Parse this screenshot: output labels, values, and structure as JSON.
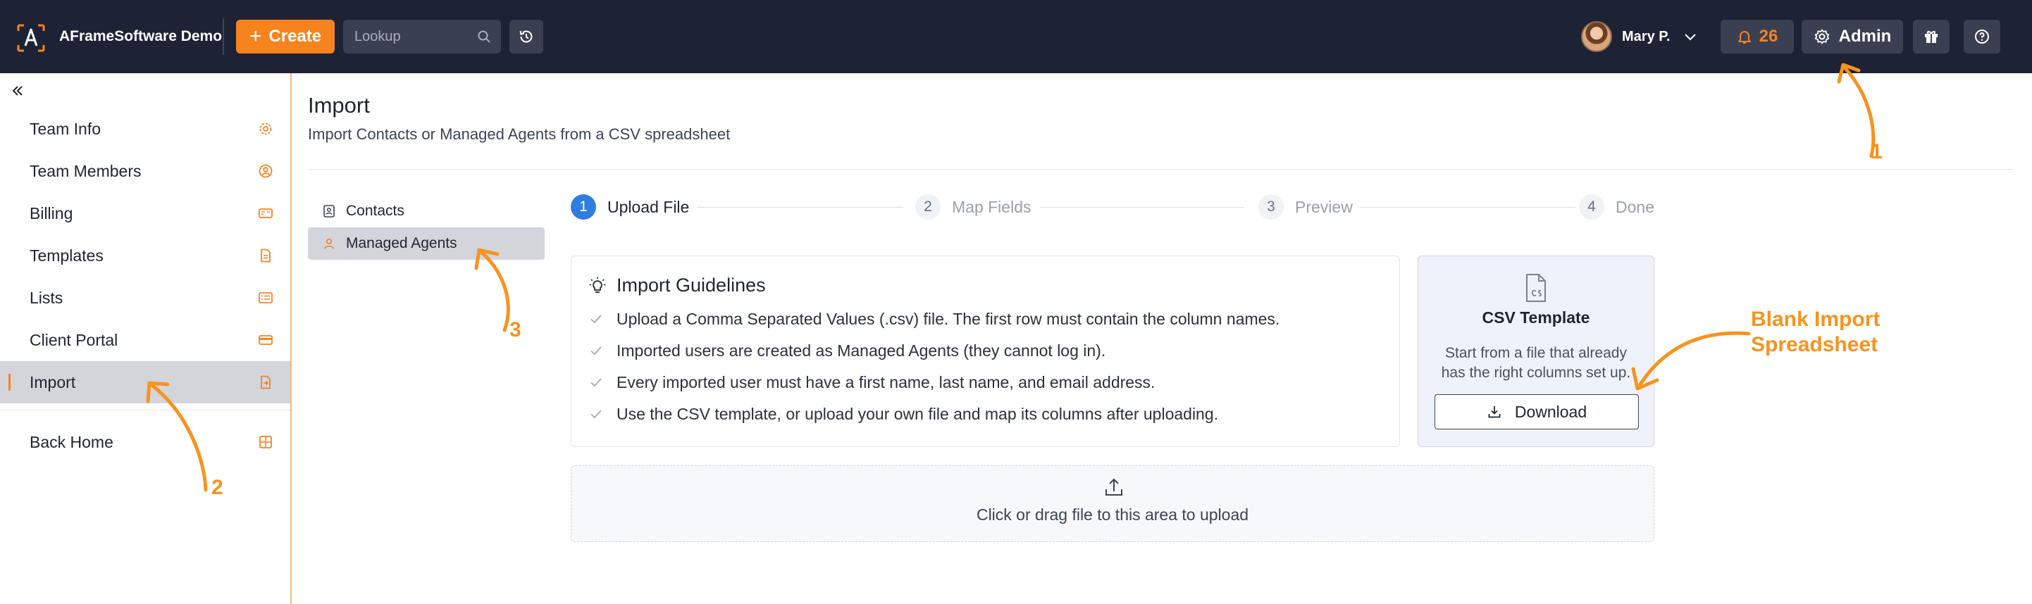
{
  "header": {
    "brand": "AFrameSoftware Demo",
    "create_label": "Create",
    "lookup_placeholder": "Lookup",
    "user_name": "Mary P.",
    "notification_count": "26",
    "admin_label": "Admin"
  },
  "sidebar": {
    "items": [
      {
        "label": "Team Info",
        "icon": "gear-icon"
      },
      {
        "label": "Team Members",
        "icon": "user-circle-icon"
      },
      {
        "label": "Billing",
        "icon": "card-icon"
      },
      {
        "label": "Templates",
        "icon": "document-icon"
      },
      {
        "label": "Lists",
        "icon": "list-icon"
      },
      {
        "label": "Client Portal",
        "icon": "credit-card-icon"
      },
      {
        "label": "Import",
        "icon": "file-import-icon",
        "active": true
      }
    ],
    "back_home": {
      "label": "Back Home",
      "icon": "grid-icon"
    }
  },
  "main": {
    "title": "Import",
    "subtitle": "Import Contacts or Managed Agents from a CSV spreadsheet",
    "subnav": [
      {
        "label": "Contacts",
        "icon": "contact-card-icon"
      },
      {
        "label": "Managed Agents",
        "icon": "user-icon",
        "active": true
      }
    ],
    "steps": [
      {
        "num": "1",
        "label": "Upload File",
        "active": true
      },
      {
        "num": "2",
        "label": "Map Fields"
      },
      {
        "num": "3",
        "label": "Preview"
      },
      {
        "num": "4",
        "label": "Done"
      }
    ],
    "guidelines": {
      "title": "Import Guidelines",
      "items": [
        "Upload a Comma Separated Values (.csv) file. The first row must contain the column names.",
        "Imported users are created as Managed Agents (they cannot log in).",
        "Every imported user must have a first name, last name, and email address.",
        "Use the CSV template, or upload your own file and map its columns after uploading."
      ]
    },
    "csv_template": {
      "title": "CSV Template",
      "description": "Start from a file that already has the right columns set up.",
      "download_label": "Download"
    },
    "upload": {
      "text": "Click or drag file to this area to upload"
    }
  },
  "annotations": {
    "one": "1",
    "two": "2",
    "three": "3",
    "blank_line1": "Blank Import",
    "blank_line2": "Spreadsheet",
    "color": "#f7931e"
  },
  "colors": {
    "topbar": "#1e2235",
    "accent": "#f7831f",
    "step_active": "#2f7de1"
  }
}
